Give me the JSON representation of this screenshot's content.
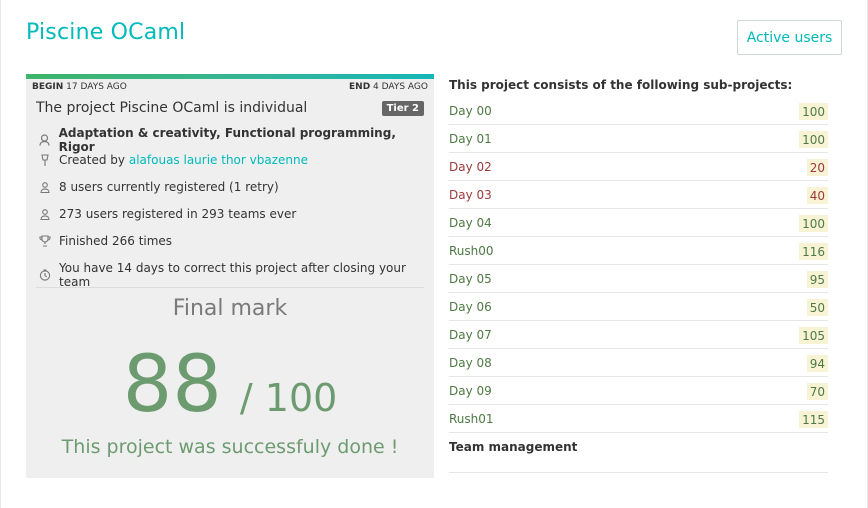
{
  "header": {
    "title": "Piscine OCaml",
    "active_users_label": "Active users"
  },
  "card": {
    "begin_label": "BEGIN",
    "begin_value": "17 DAYS AGO",
    "end_label": "END",
    "end_value": "4 DAYS AGO",
    "project_text": "The project Piscine OCaml is individual",
    "tier": "Tier 2",
    "skills": "Adaptation & creativity, Functional programming, Rigor",
    "created_by_label": "Created by",
    "creators": "alafouas laurie thor vbazenne",
    "registered": "8 users currently registered (1 retry)",
    "registered_ever": "273 users registered in 293 teams ever",
    "finished": "Finished 266 times",
    "correction_delay": "You have 14 days to correct this project after closing your team",
    "final_mark_label": "Final mark",
    "mark": "88",
    "mark_max": "/ 100",
    "success_text": "This project was successfuly done !"
  },
  "subprojects": {
    "title": "This project consists of the following sub-projects:",
    "items": [
      {
        "name": "Day 00",
        "score": "100",
        "status": "ok"
      },
      {
        "name": "Day 01",
        "score": "100",
        "status": "ok"
      },
      {
        "name": "Day 02",
        "score": "20",
        "status": "ko"
      },
      {
        "name": "Day 03",
        "score": "40",
        "status": "ko"
      },
      {
        "name": "Day 04",
        "score": "100",
        "status": "ok"
      },
      {
        "name": "Rush00",
        "score": "116",
        "status": "ok"
      },
      {
        "name": "Day 05",
        "score": "95",
        "status": "ok"
      },
      {
        "name": "Day 06",
        "score": "50",
        "status": "ok"
      },
      {
        "name": "Day 07",
        "score": "105",
        "status": "ok"
      },
      {
        "name": "Day 08",
        "score": "94",
        "status": "ok"
      },
      {
        "name": "Day 09",
        "score": "70",
        "status": "ok"
      },
      {
        "name": "Rush01",
        "score": "115",
        "status": "ok"
      }
    ],
    "team_management_label": "Team management"
  },
  "colors": {
    "accent": "#00babc",
    "success": "#6d9b70",
    "fail": "#9c3a3a",
    "score_bg": "#f9f3d6"
  },
  "icons": [
    "skills-icon",
    "creator-icon",
    "user-icon",
    "users-icon",
    "trophy-icon",
    "clock-icon"
  ]
}
